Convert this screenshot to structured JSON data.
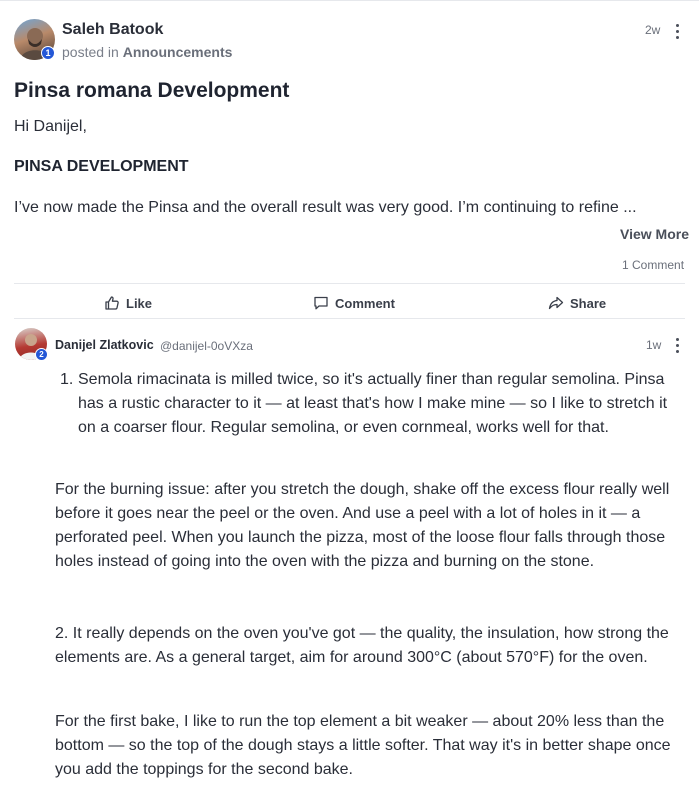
{
  "post": {
    "author": "Saleh Batook",
    "author_badge": "1",
    "posted_in_prefix": "posted in",
    "category": "Announcements",
    "time": "2w",
    "title": "Pinsa romana Development",
    "greeting": "Hi Danijel,",
    "section_heading": "PINSA DEVELOPMENT",
    "excerpt": "I’ve now made the Pinsa and the overall result was very good. I’m continuing to refine ...",
    "view_more": "View More",
    "comment_count": "1 Comment"
  },
  "actions": {
    "like": "Like",
    "comment": "Comment",
    "share": "Share"
  },
  "comment": {
    "author": "Danijel Zlatkovic",
    "handle": "@danijel-0oVXza",
    "author_badge": "2",
    "time": "1w",
    "list_number": "1.",
    "list_item": "Semola rimacinata is milled twice, so it's actually finer than regular semolina. Pinsa has a rustic character to it — at least that's how I make mine — so I like to stretch it on a coarser flour. Regular semolina, or even cornmeal, works well for that.",
    "para1": "For the burning issue: after you stretch the dough, shake off the excess flour really well before it goes near the peel or the oven. And use a peel with a lot of holes in it — a perforated peel. When you launch the pizza, most of the loose flour falls through those holes instead of going into the oven with the pizza and burning on the stone.",
    "para2": "2. It really depends on the oven you've got — the quality, the insulation, how strong the elements are. As a general target, aim for around 300°C (about 570°F) for the oven.",
    "para3": "For the first bake, I like to run the top element a bit weaker — about 20% less than the bottom — so the top of the dough stays a little softer. That way it's in better shape once you add the toppings for the second bake."
  },
  "colors": {
    "accent_blue": "#2457d6",
    "divider": "#e6e8ec"
  }
}
